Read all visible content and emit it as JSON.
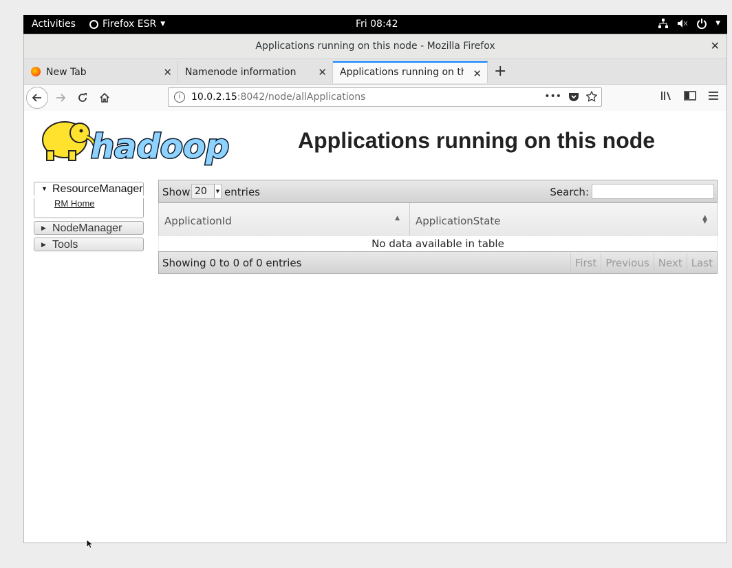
{
  "system": {
    "activities": "Activities",
    "app_menu": "Firefox ESR",
    "clock": "Fri 08:42"
  },
  "window": {
    "title": "Applications running on this node - Mozilla Firefox"
  },
  "tabs": [
    {
      "label": "New Tab"
    },
    {
      "label": "Namenode information"
    },
    {
      "label": "Applications running on this n"
    }
  ],
  "urlbar": {
    "host": "10.0.2.15",
    "rest": ":8042/node/allApplications"
  },
  "page": {
    "logo_text": "hadoop",
    "title": "Applications running on this node"
  },
  "nav": {
    "resource_manager": "ResourceManager",
    "rm_home": "RM Home",
    "node_manager": "NodeManager",
    "tools": "Tools"
  },
  "table": {
    "show_label": "Show",
    "page_size": "20",
    "entries_label": "entries",
    "search_label": "Search:",
    "columns": [
      "ApplicationId",
      "ApplicationState"
    ],
    "empty_message": "No data available in table",
    "info": "Showing 0 to 0 of 0 entries",
    "pager": [
      "First",
      "Previous",
      "Next",
      "Last"
    ]
  },
  "colors": {
    "accent_tab": "#0a84ff",
    "topbar": "#000000"
  }
}
